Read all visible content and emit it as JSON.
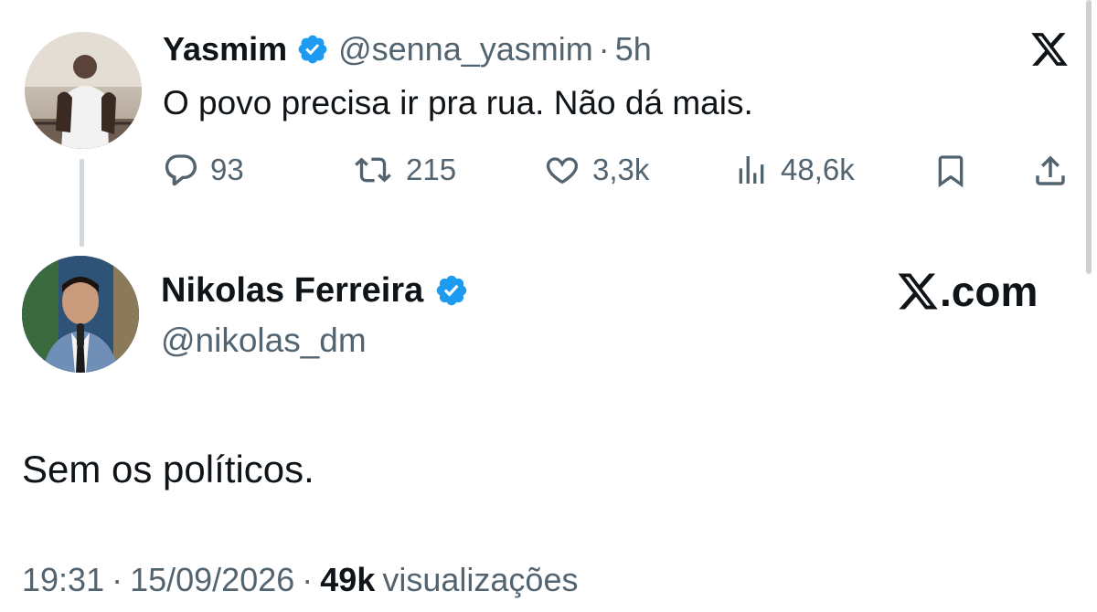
{
  "reply_to": {
    "display_name": "Yasmim",
    "handle": "@senna_yasmim",
    "separator": "·",
    "time": "5h",
    "text": "O povo precisa ir pra rua. Não dá mais.",
    "stats": {
      "replies": "93",
      "reposts": "215",
      "likes": "3,3k",
      "views": "48,6k"
    }
  },
  "tweet": {
    "display_name": "Nikolas Ferreira",
    "handle": "@nikolas_dm",
    "text": "Sem os políticos.",
    "time": "19:31",
    "separator1": "·",
    "date": "15/09/2026",
    "separator2": "·",
    "views_count": "49k",
    "views_label": "visualizações"
  },
  "brand": {
    "watermark_suffix": ".com"
  },
  "colors": {
    "verified": "#1d9bf0",
    "muted": "#536471",
    "text": "#0f1419",
    "thread_line": "#cfd9de"
  },
  "icons": [
    "verified-badge-icon",
    "x-logo-icon",
    "reply-icon",
    "repost-icon",
    "like-icon",
    "views-icon",
    "bookmark-icon",
    "share-icon"
  ]
}
